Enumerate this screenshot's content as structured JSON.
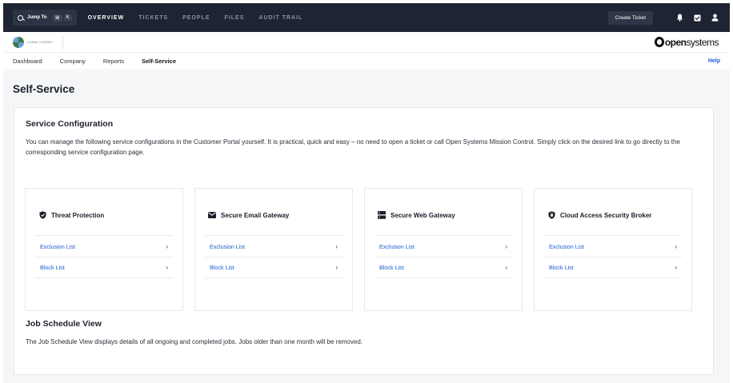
{
  "topbar": {
    "jump_label": "Jump To",
    "kbd_cmd": "⌘",
    "kbd_k": "K",
    "nav": [
      "OVERVIEW",
      "TICKETS",
      "PEOPLE",
      "FILES",
      "AUDIT TRAIL"
    ],
    "create_ticket": "Create Ticket"
  },
  "brand": {
    "company_text": "GLOBAL COMPANY",
    "os_logo": "open",
    "os_logo_rest": "systems"
  },
  "subnav": {
    "items": [
      "Dashboard",
      "Company",
      "Reports",
      "Self-Service"
    ],
    "help": "Help"
  },
  "page": {
    "title": "Self-Service",
    "service_config_title": "Service Configuration",
    "service_config_text": "You can manage the following service configurations in the Customer Portal yourself. It is practical, quick and easy – no need to open a ticket or call Open Systems Mission Control. Simply click on the desired link to go directly to the corresponding service configuration page.",
    "cards": [
      {
        "title": "Threat Protection",
        "icon": "shield-check-icon",
        "links": [
          "Exclusion List",
          "Block List"
        ]
      },
      {
        "title": "Secure Email Gateway",
        "icon": "envelope-icon",
        "links": [
          "Exclusion List",
          "Block List"
        ]
      },
      {
        "title": "Secure Web Gateway",
        "icon": "server-icon",
        "links": [
          "Exclusion List",
          "Block List"
        ]
      },
      {
        "title": "Cloud Access Security Broker",
        "icon": "shield-lock-icon",
        "links": [
          "Exclusion List",
          "Block List"
        ]
      }
    ],
    "job_title": "Job Schedule View",
    "job_text": "The Job Schedule View displays details of all ongoing and completed jobs. Jobs older than one month will be removed."
  },
  "colors": {
    "topbar": "#1e2433",
    "link": "#1f5fd1"
  }
}
